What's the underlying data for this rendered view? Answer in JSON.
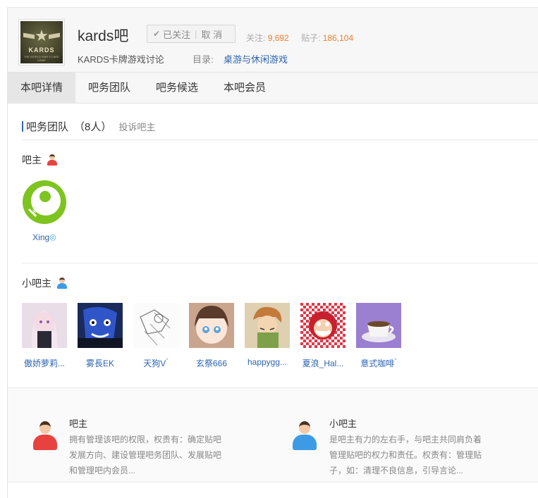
{
  "header": {
    "forum_name": "kards吧",
    "follow_label": "已关注",
    "cancel_label": "取 消",
    "followers_label": "关注:",
    "followers_count": "9,692",
    "posts_label": "贴子:",
    "posts_count": "186,104",
    "description": "KARDS卡牌游戏讨论",
    "directory_label": "目录:",
    "directory_link": "桌游与休闲游戏",
    "logo_text": "KARDS",
    "logo_sub": "THE WORLD WAR II CARD GAME"
  },
  "tabs": [
    {
      "label": "本吧详情",
      "active": true
    },
    {
      "label": "吧务团队",
      "active": false
    },
    {
      "label": "吧务候选",
      "active": false
    },
    {
      "label": "本吧会员",
      "active": false
    }
  ],
  "team": {
    "title": "吧务团队",
    "count": "（8人）",
    "complain": "投诉吧主"
  },
  "owner_section": {
    "label": "吧主",
    "members": [
      {
        "name": "Xing",
        "mark": "◎"
      }
    ]
  },
  "assistant_section": {
    "label": "小吧主",
    "members": [
      {
        "name": "傲娇萝莉...",
        "mark": ""
      },
      {
        "name": "雾長EK",
        "mark": ""
      },
      {
        "name": "天狗V",
        "mark": "°"
      },
      {
        "name": "玄祭666",
        "mark": ""
      },
      {
        "name": "happygg...",
        "mark": ""
      },
      {
        "name": "夏浪_Hal...",
        "mark": ""
      },
      {
        "name": "意式咖啡",
        "mark": "°"
      }
    ]
  },
  "info": {
    "owner": {
      "title": "吧主",
      "text": "拥有管理该吧的权限，权责有：确定贴吧发展方向、建设管理吧务团队、发展贴吧和管理吧内会员..."
    },
    "assistant": {
      "title": "小吧主",
      "text": "是吧主有力的左右手，与吧主共同肩负着管理贴吧的权力和责任。权责有：管理贴子，如：清理不良信息，引导言论..."
    }
  },
  "colors": {
    "accent": "#2d64b3",
    "stat_number": "#f07d2e",
    "owner_icon": "#e64340",
    "assistant_icon": "#3d9be6"
  }
}
